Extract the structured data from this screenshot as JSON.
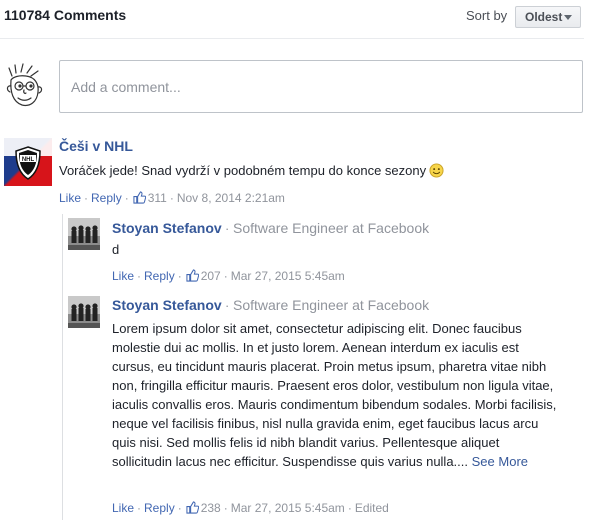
{
  "header": {
    "comment_count": "110784 Comments",
    "sort_label": "Sort by",
    "sort_value": "Oldest"
  },
  "composer": {
    "placeholder": "Add a comment..."
  },
  "comments": [
    {
      "author": "Češi v NHL",
      "text": "Voráček jede! Snad vydrží v podobném tempu do konce sezony",
      "emoji": "smiley-icon",
      "like_label": "Like",
      "reply_label": "Reply",
      "likes": "311",
      "timestamp": "Nov 8, 2014 2:21am"
    }
  ],
  "replies": [
    {
      "author": "Stoyan Stefanov",
      "title": "Software Engineer at Facebook",
      "text": "d",
      "like_label": "Like",
      "reply_label": "Reply",
      "likes": "207",
      "timestamp": "Mar 27, 2015 5:45am"
    },
    {
      "author": "Stoyan Stefanov",
      "title": "Software Engineer at Facebook",
      "text": "Lorem ipsum dolor sit amet, consectetur adipiscing elit. Donec faucibus molestie dui ac mollis. In et justo lorem. Aenean interdum ex iaculis est cursus, eu tincidunt mauris placerat. Proin metus ipsum, pharetra vitae nibh non, fringilla efficitur mauris. Praesent eros dolor, vestibulum non ligula vitae, iaculis convallis eros. Mauris condimentum bibendum sodales. Morbi facilisis, neque vel facilisis finibus, nisl nulla gravida enim, eget faucibus lacus arcu quis nisi. Sed mollis felis id nibh blandit varius. Pellentesque aliquet sollicitudin lacus nec efficitur. Suspendisse quis varius nulla....",
      "see_more": "See More",
      "like_label": "Like",
      "reply_label": "Reply",
      "likes": "238",
      "timestamp": "Mar 27, 2015 5:45am",
      "edited": "Edited"
    }
  ],
  "separators": {
    "dot": "·"
  },
  "colors": {
    "link": "#4267b2",
    "author": "#365899",
    "muted": "#90949c"
  }
}
